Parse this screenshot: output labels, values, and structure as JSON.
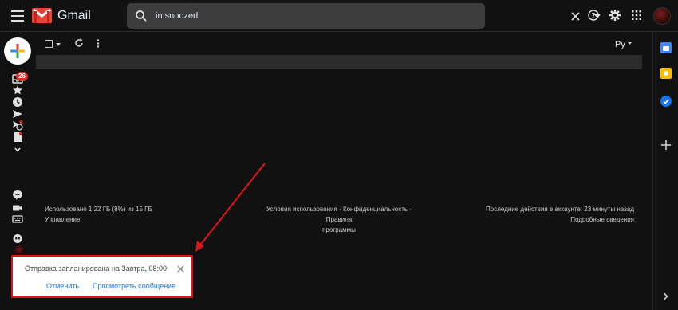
{
  "header": {
    "app_name": "Gmail",
    "search_value": "in:snoozed"
  },
  "sidebar": {
    "inbox_unread_count": "26"
  },
  "toolbar": {
    "language": "Ру"
  },
  "footer": {
    "storage": "Использовано 1,22 ГБ (8%) из 15 ГБ",
    "manage": "Управление",
    "terms": "Условия использования",
    "privacy": "Конфиденциальность",
    "program_policies_1": "Правила",
    "program_policies_2": "программы",
    "sep": "·",
    "last_activity": "Последние действия в аккаунте: 23 минуты назад",
    "details": "Подробные сведения"
  },
  "toast": {
    "message": "Отправка запланирована на Завтра, 08:00",
    "undo": "Отменить",
    "view": "Просмотреть сообщение"
  },
  "colors": {
    "background": "#111111",
    "accent_blue": "#1a73e8",
    "badge_red": "#d93025",
    "highlight_red": "#e0141d"
  }
}
